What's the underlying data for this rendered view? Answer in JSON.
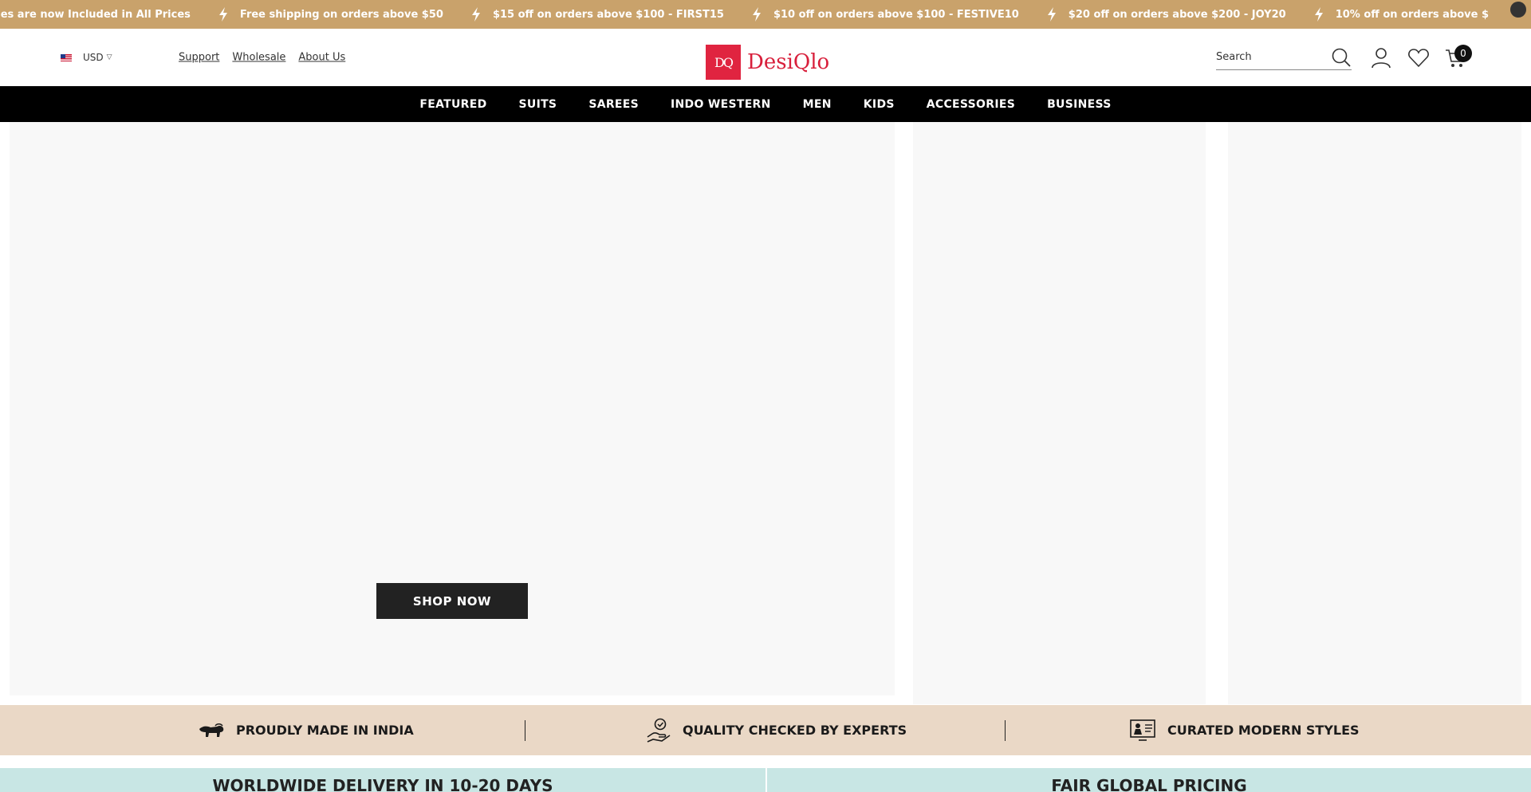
{
  "announcement": {
    "items": [
      "Duties are now Included in All Prices",
      "Free shipping on orders above $50",
      "$15 off on orders above $100 - FIRST15",
      "$10 off on orders above $100 - FESTIVE10",
      "$20 off on orders above $200 - JOY20",
      "10% off on orders above $"
    ]
  },
  "header": {
    "currency": "USD",
    "links": [
      "Support",
      "Wholesale",
      "About Us"
    ],
    "logo_mark": "DQ",
    "logo_text": "DesiQlo",
    "search_placeholder": "Search",
    "cart_count": "0"
  },
  "nav": {
    "items": [
      "FEATURED",
      "SUITS",
      "SAREES",
      "INDO WESTERN",
      "MEN",
      "KIDS",
      "ACCESSORIES",
      "BUSINESS"
    ]
  },
  "hero": {
    "cta_label": "SHOP NOW"
  },
  "features": {
    "items": [
      "PROUDLY MADE IN INDIA",
      "QUALITY CHECKED BY EXPERTS",
      "CURATED MODERN STYLES"
    ]
  },
  "strips": {
    "left": "WORLDWIDE DELIVERY IN 10-20 DAYS",
    "right": "FAIR GLOBAL PRICING"
  },
  "colors": {
    "announcement_bg": "#c9a26b",
    "brand": "#e02440",
    "nav_bg": "#000000",
    "features_bg": "#ead8c6",
    "strip_bg": "#c8e6e4"
  }
}
